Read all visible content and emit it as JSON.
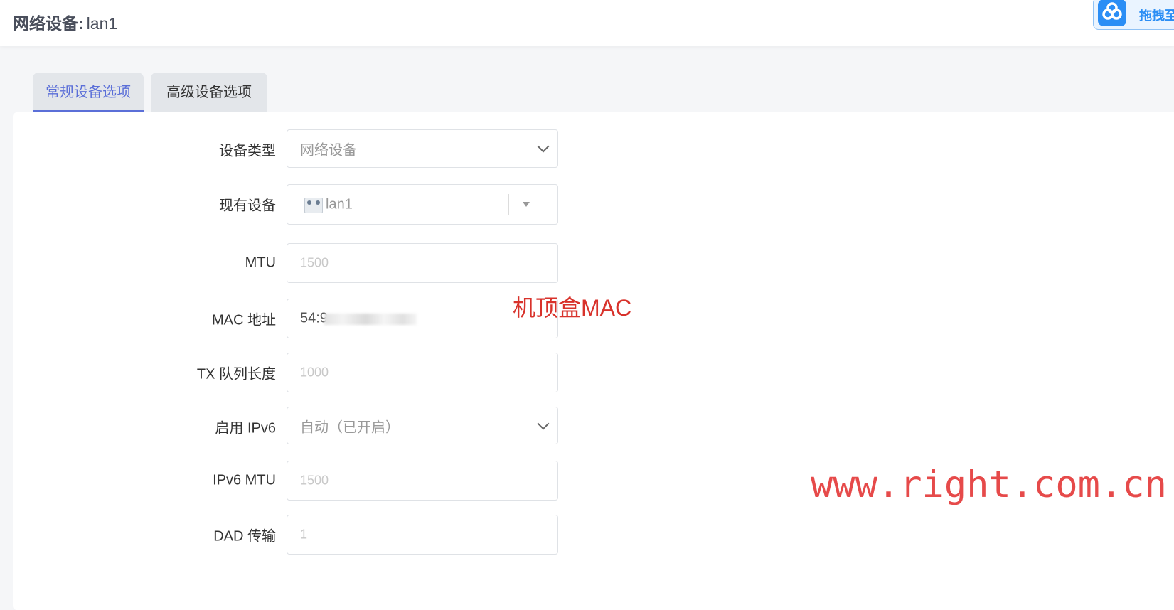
{
  "header": {
    "title": "网络设备:",
    "device_name": "lan1",
    "badge": {
      "icon": "baidu-cloud-icon",
      "text": "拖拽至"
    }
  },
  "tabs": [
    {
      "label": "常规设备选项",
      "active": true
    },
    {
      "label": "高级设备选项",
      "active": false
    }
  ],
  "form": {
    "device_type": {
      "label": "设备类型",
      "value": "网络设备"
    },
    "existing_device": {
      "label": "现有设备",
      "value": "lan1",
      "icon": "network-device-icon"
    },
    "mtu": {
      "label": "MTU",
      "placeholder": "1500"
    },
    "mac": {
      "label": "MAC 地址",
      "value_visible": "54:9"
    },
    "txqueuelen": {
      "label": "TX 队列长度",
      "placeholder": "1000"
    },
    "ipv6": {
      "label": "启用 IPv6",
      "value": "自动（已开启）"
    },
    "ipv6_mtu": {
      "label": "IPv6 MTU",
      "placeholder": "1500"
    },
    "dad": {
      "label": "DAD 传输",
      "placeholder": "1"
    }
  },
  "annotations": {
    "mac_note": "机顶盒MAC",
    "watermark": "www.right.com.cn"
  },
  "colors": {
    "accent": "#5b6fd8",
    "annotation_red": "#d8322b",
    "watermark_red": "#e64a4a",
    "badge_blue": "#2b8ef5"
  }
}
